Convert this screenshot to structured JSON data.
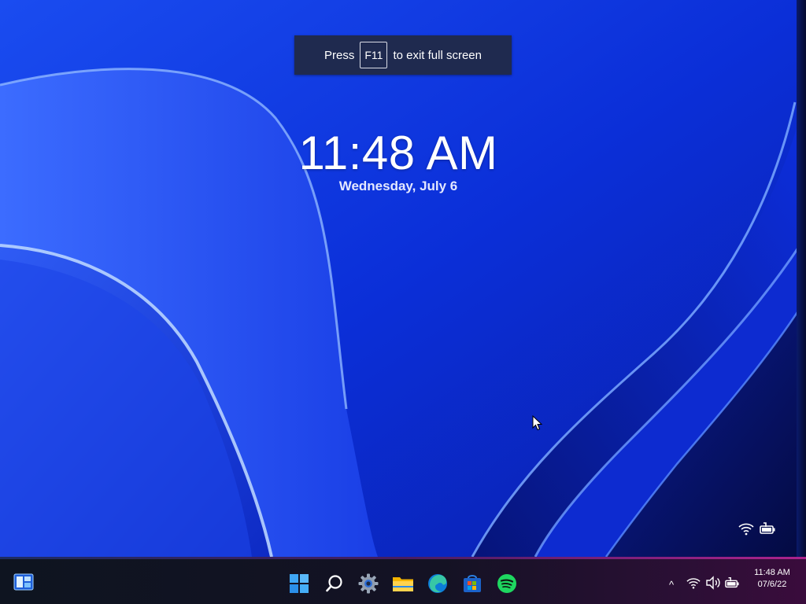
{
  "notice": {
    "press": "Press",
    "key": "F11",
    "rest": "to exit full screen"
  },
  "lock": {
    "time": "11:48 AM",
    "date": "Wednesday, July 6",
    "status_icons": [
      "wifi-icon",
      "battery-charging-icon"
    ]
  },
  "taskbar": {
    "widgets": "widgets-icon",
    "apps": [
      {
        "name": "start-button",
        "icon": "windows-logo-icon"
      },
      {
        "name": "search-button",
        "icon": "search-icon"
      },
      {
        "name": "settings-app",
        "icon": "gear-icon"
      },
      {
        "name": "file-explorer-app",
        "icon": "folder-icon"
      },
      {
        "name": "edge-app",
        "icon": "edge-icon"
      },
      {
        "name": "store-app",
        "icon": "store-icon"
      },
      {
        "name": "spotify-app",
        "icon": "spotify-icon"
      }
    ],
    "tray": {
      "overflow": "^",
      "icons": [
        "wifi-icon",
        "volume-icon",
        "battery-charging-icon"
      ],
      "time": "11:48 AM",
      "date": "07/6/22"
    }
  },
  "colors": {
    "wallpaper_base": "#0a2fd6",
    "taskbar_bg": "#141224",
    "accent": "#3fa7f5",
    "spotify": "#1ed760"
  }
}
